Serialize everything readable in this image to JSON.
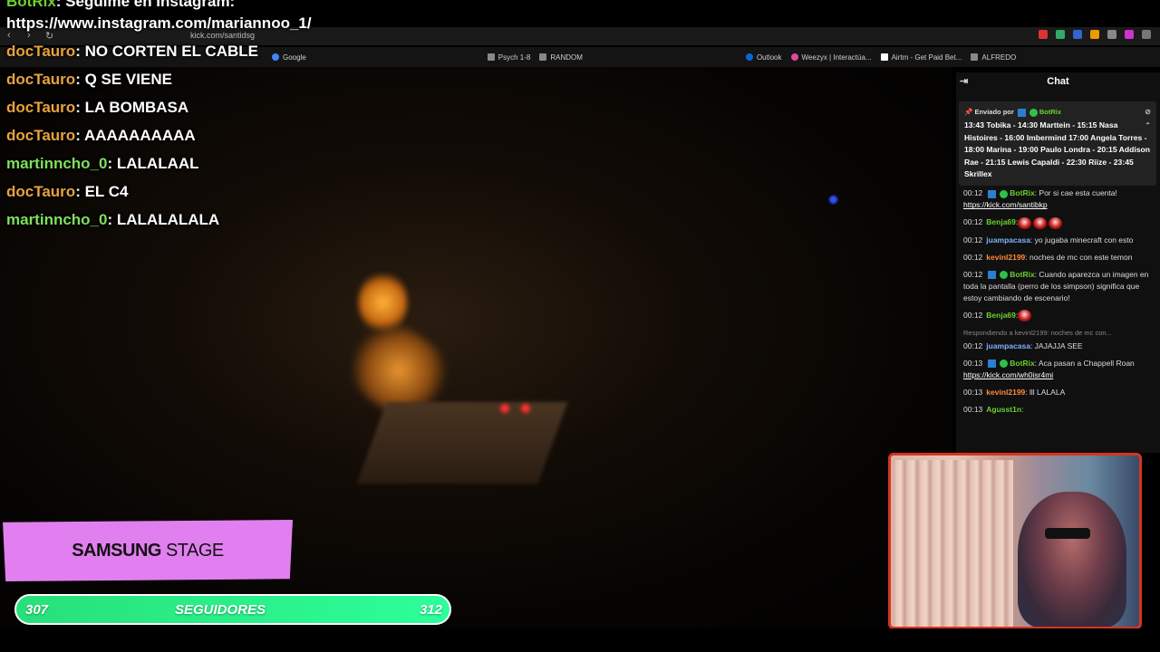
{
  "overlay_chat": [
    {
      "user": "BotRix",
      "text": ": Seguime en Instagram:"
    },
    {
      "user": "",
      "text": "https://www.instagram.com/mariannoo_1/"
    },
    {
      "user": "docTauro",
      "text": ": NO CORTEN EL CABLE"
    },
    {
      "user": "docTauro",
      "text": ": Q SE VIENE"
    },
    {
      "user": "docTauro",
      "text": ": LA BOMBASA"
    },
    {
      "user": "docTauro",
      "text": ": AAAAAAAAAA"
    },
    {
      "user": "martinncho_0",
      "text": ": LALALAAL"
    },
    {
      "user": "docTauro",
      "text": ": EL C4"
    },
    {
      "user": "martinncho_0",
      "text": ": LALALALALA"
    }
  ],
  "browser": {
    "url": "kick.com/santidsg",
    "bookmarks": [
      "Google",
      "Psych 1-8",
      "RANDOM",
      "Outlook",
      "Weezyx | Interactúa...",
      "Airtm - Get Paid Bet...",
      "ALFREDO"
    ]
  },
  "chat": {
    "title": "Chat",
    "pinned_by_label": "Enviado por",
    "pinned_by_user": "BotRix",
    "pinned_text": "13:43 Tobika - 14:30 Marttein - 15:15 Nasa Histoires - 16:00 Imbermind 17:00 Angela Torres - 18:00 Marina - 19:00 Paulo Londra - 20:15 Addison Rae - 21:15 Lewis Capaldi - 22:30 Riize - 23:45 Skrillex",
    "messages": [
      {
        "time": "00:12",
        "user": "BotRix",
        "color": "#6bd12f",
        "text": ": Por si cae esta cuenta!",
        "link": "https://kick.com/santibkp"
      },
      {
        "time": "00:12",
        "user": "Benja69",
        "color": "#6bd12f",
        "text": ":",
        "link": ""
      },
      {
        "time": "00:12",
        "user": "juampacasa",
        "color": "#7fb3ff",
        "text": ": yo jugaba minecraft con esto",
        "link": ""
      },
      {
        "time": "00:12",
        "user": "kevinl2199",
        "color": "#ff8a3a",
        "text": ": noches de mc con este temon",
        "link": ""
      },
      {
        "time": "00:12",
        "user": "BotRix",
        "color": "#6bd12f",
        "text": ": Cuando aparezca un imagen en toda la pantalla (perro de los simpson) significa que estoy cambiando de escenario!",
        "link": ""
      },
      {
        "time": "00:12",
        "user": "Benja69",
        "color": "#6bd12f",
        "text": ":",
        "link": ""
      },
      {
        "time": "00:12",
        "user": "juampacasa",
        "color": "#7fb3ff",
        "text": ": JAJAJJA SEE",
        "link": "",
        "reply": "Respondiendo a kevinl2199: noches de mc con..."
      },
      {
        "time": "00:13",
        "user": "BotRix",
        "color": "#6bd12f",
        "text": ": Aca pasan a Chappell Roan",
        "link": "https://kick.com/wh0isr4mi"
      },
      {
        "time": "00:13",
        "user": "kevinl2199",
        "color": "#ff8a3a",
        "text": ": lll LALALA",
        "link": ""
      },
      {
        "time": "00:13",
        "user": "Agusst1n",
        "color": "#6bd12f",
        "text": ":",
        "link": ""
      }
    ]
  },
  "stage": {
    "bold": "SAMSUNG",
    "rest": "STAGE"
  },
  "followers": {
    "current": "307",
    "label": "SEGUIDORES",
    "goal": "312",
    "progress": 0.984
  }
}
